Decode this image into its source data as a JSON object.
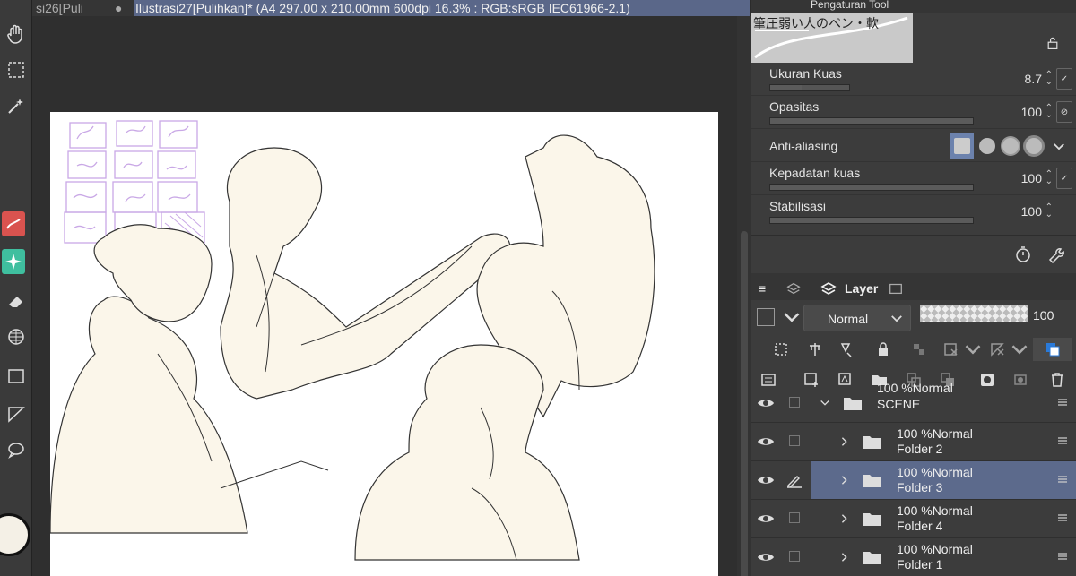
{
  "document_tabs": {
    "inactive": "si26[Puli",
    "active": "Ilustrasi27[Pulihkan]* (A4 297.00 x 210.00mm 600dpi 16.3% : RGB:sRGB IEC61966-2.1)"
  },
  "tool_property": {
    "panel_title": "Pengaturan Tool",
    "brush_name": "筆圧弱い人のペン・軟",
    "properties": [
      {
        "label": "Ukuran Kuas",
        "value": "8.7",
        "level": 0.4
      },
      {
        "label": "Opasitas",
        "value": "100",
        "level": 1.0
      },
      {
        "label": "Anti-aliasing",
        "value": ""
      },
      {
        "label": "Kepadatan kuas",
        "value": "100",
        "level": 1.0
      },
      {
        "label": "Stabilisasi",
        "value": "100",
        "level": 1.0
      }
    ]
  },
  "layer_panel": {
    "tab_label": "Layer",
    "blend_mode": "Normal",
    "opacity": "100",
    "layers": [
      {
        "mode": "100 %Normal",
        "name": "SCENE",
        "selected": false,
        "level": 0,
        "expanded": true,
        "editing": false
      },
      {
        "mode": "100 %Normal",
        "name": "Folder 2",
        "selected": false,
        "level": 1,
        "expanded": false,
        "editing": false
      },
      {
        "mode": "100 %Normal",
        "name": "Folder 3",
        "selected": true,
        "level": 1,
        "expanded": false,
        "editing": true
      },
      {
        "mode": "100 %Normal",
        "name": "Folder 4",
        "selected": false,
        "level": 1,
        "expanded": false,
        "editing": false
      },
      {
        "mode": "100 %Normal",
        "name": "Folder 1",
        "selected": false,
        "level": 1,
        "expanded": false,
        "editing": false
      }
    ]
  },
  "colors": {
    "selected_tab": "#5a6789",
    "selected_layer": "#5c6a8c",
    "accent_red": "#d9534f",
    "accent_teal": "#3fbf9f",
    "thumbnail_lines": "#c9a8e6",
    "figure_fill": "#fbf6ea"
  }
}
